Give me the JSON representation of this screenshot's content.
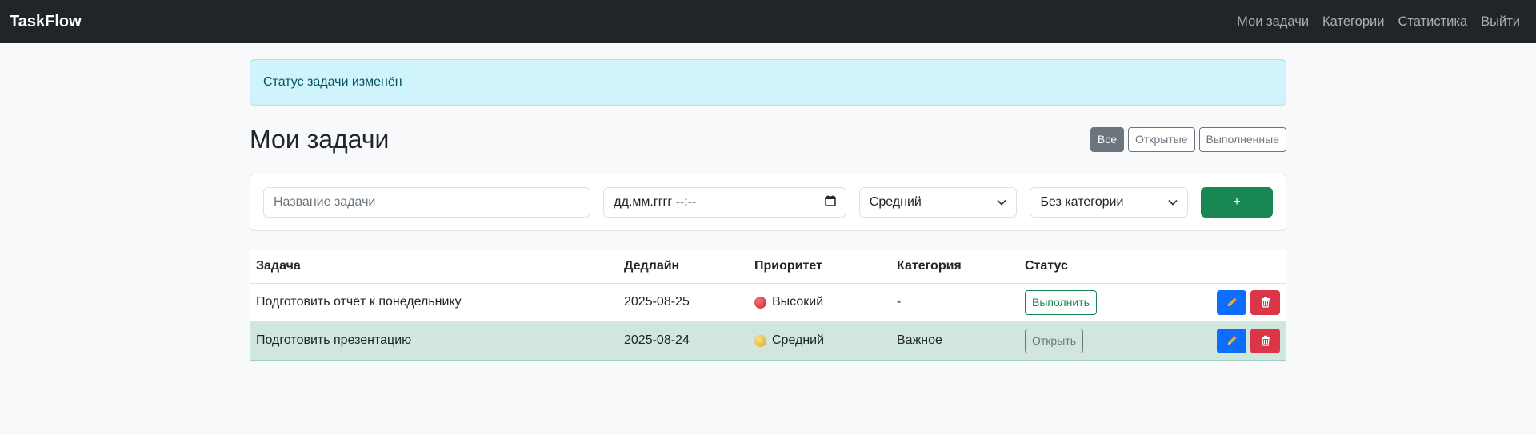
{
  "navbar": {
    "brand": "TaskFlow",
    "links": [
      "Мои задачи",
      "Категории",
      "Статистика",
      "Выйти"
    ]
  },
  "alert": {
    "text": "Статус задачи изменён"
  },
  "page": {
    "title": "Мои задачи",
    "filters": [
      {
        "label": "Все",
        "active": true
      },
      {
        "label": "Открытые",
        "active": false
      },
      {
        "label": "Выполненные",
        "active": false
      }
    ]
  },
  "form": {
    "title_placeholder": "Название задачи",
    "date_placeholder": "дд.мм.гггг --:--",
    "priority_value": "Средний",
    "category_value": "Без категории",
    "add_label": "+"
  },
  "table": {
    "headers": [
      "Задача",
      "Дедлайн",
      "Приоритет",
      "Категория",
      "Статус"
    ],
    "rows": [
      {
        "task": "Подготовить отчёт к понедельнику",
        "deadline": "2025-08-25",
        "priority": "Высокий",
        "priority_color": "#dc3545",
        "category": "-",
        "status_label": "Выполнить",
        "done": false
      },
      {
        "task": "Подготовить презентацию",
        "deadline": "2025-08-24",
        "priority": "Средний",
        "priority_color": "#f0b429",
        "category": "Важное",
        "status_label": "Открыть",
        "done": true
      }
    ]
  },
  "icons": {
    "edit": "pencil-icon",
    "delete": "trash-icon",
    "calendar": "calendar-icon",
    "dropdown": "chevron-down-icon"
  }
}
